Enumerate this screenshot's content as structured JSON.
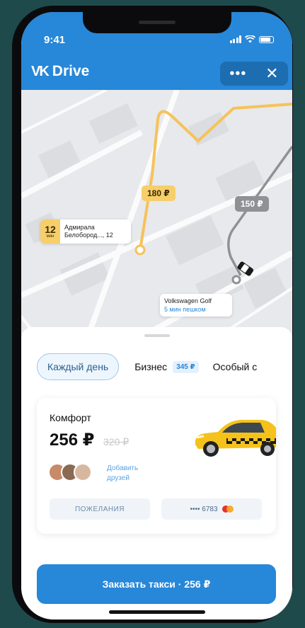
{
  "status_bar": {
    "time": "9:41"
  },
  "header": {
    "brand_logo": "VK",
    "brand_name": "Drive",
    "more_icon": "more-icon",
    "close_icon": "close-icon"
  },
  "map": {
    "price_tags": [
      "180 ₽",
      "150 ₽"
    ],
    "eta": {
      "minutes": "12",
      "unit": "мин",
      "address_line1": "Адмирала",
      "address_line2": "Белобород..., 12"
    },
    "car": {
      "model": "Volkswagen Golf",
      "walk": "5 мин пешком"
    }
  },
  "tariffs": {
    "active": "Каждый день",
    "items": [
      {
        "label": "Бизнес",
        "price": "345 ₽"
      },
      {
        "label": "Особый с"
      }
    ]
  },
  "offer": {
    "title": "Комфорт",
    "price": "256 ₽",
    "old_price": "320 ₽",
    "add_friends": "Добавить друзей",
    "wishes": "ПОЖЕЛАНИЯ",
    "card_mask": "•••• 6783"
  },
  "order_button": "Заказать такси · 256 ₽",
  "colors": {
    "brand": "#2787d8",
    "taxi_yellow": "#f6cf6b",
    "sheet_bg": "#ffffff"
  }
}
